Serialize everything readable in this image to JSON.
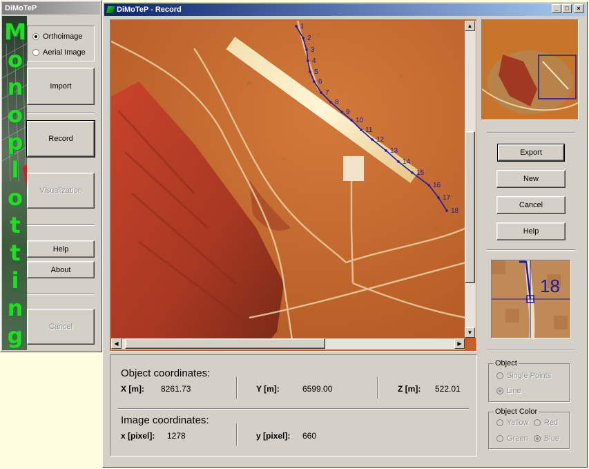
{
  "left_window": {
    "title": "DiMoTeP",
    "banner_letters": [
      "M",
      "o",
      "n",
      "o",
      "p",
      "l",
      "o",
      "t",
      "t",
      "i",
      "n",
      "g"
    ],
    "image_source": [
      {
        "label": "Orthoimage",
        "selected": true
      },
      {
        "label": "Aerial Image",
        "selected": false
      }
    ],
    "buttons": {
      "import": "Import",
      "record": "Record",
      "visualization": "Visualization",
      "help": "Help",
      "about": "About",
      "cancel": "Cancel"
    }
  },
  "record_window": {
    "title": "DiMoTeP - Record",
    "title_controls": [
      "_",
      "□",
      "×"
    ],
    "point_labels": [
      "1",
      "2",
      "3",
      "4",
      "5",
      "6",
      "7",
      "8",
      "9",
      "10",
      "11",
      "12",
      "13",
      "14",
      "15",
      "16",
      "17",
      "18"
    ],
    "buttons": {
      "export": "Export",
      "new": "New",
      "cancel": "Cancel",
      "help": "Help"
    },
    "zoom_label": "18",
    "object_coordinates": {
      "heading": "Object coordinates:",
      "x_label": "X [m]:",
      "x_value": "8261.73",
      "y_label": "Y [m]:",
      "y_value": "6599.00",
      "z_label": "Z [m]:",
      "z_value": "522.01"
    },
    "image_coordinates": {
      "heading": "Image coordinates:",
      "x_label": "x [pixel]:",
      "x_value": "1278",
      "y_label": "y [pixel]:",
      "y_value": "660"
    },
    "object_group": {
      "title": "Object",
      "options": [
        {
          "label": "Single Points",
          "selected": false
        },
        {
          "label": "Line",
          "selected": true
        }
      ]
    },
    "color_group": {
      "title": "Object Color",
      "options": [
        {
          "label": "Yellow",
          "selected": false
        },
        {
          "label": "Red",
          "selected": false
        },
        {
          "label": "Green",
          "selected": false
        },
        {
          "label": "Blue",
          "selected": true
        }
      ]
    }
  },
  "colors": {
    "banner_green": "#22dd22",
    "line_blue": "#1a1aa8",
    "terrain": "#c2622a"
  }
}
